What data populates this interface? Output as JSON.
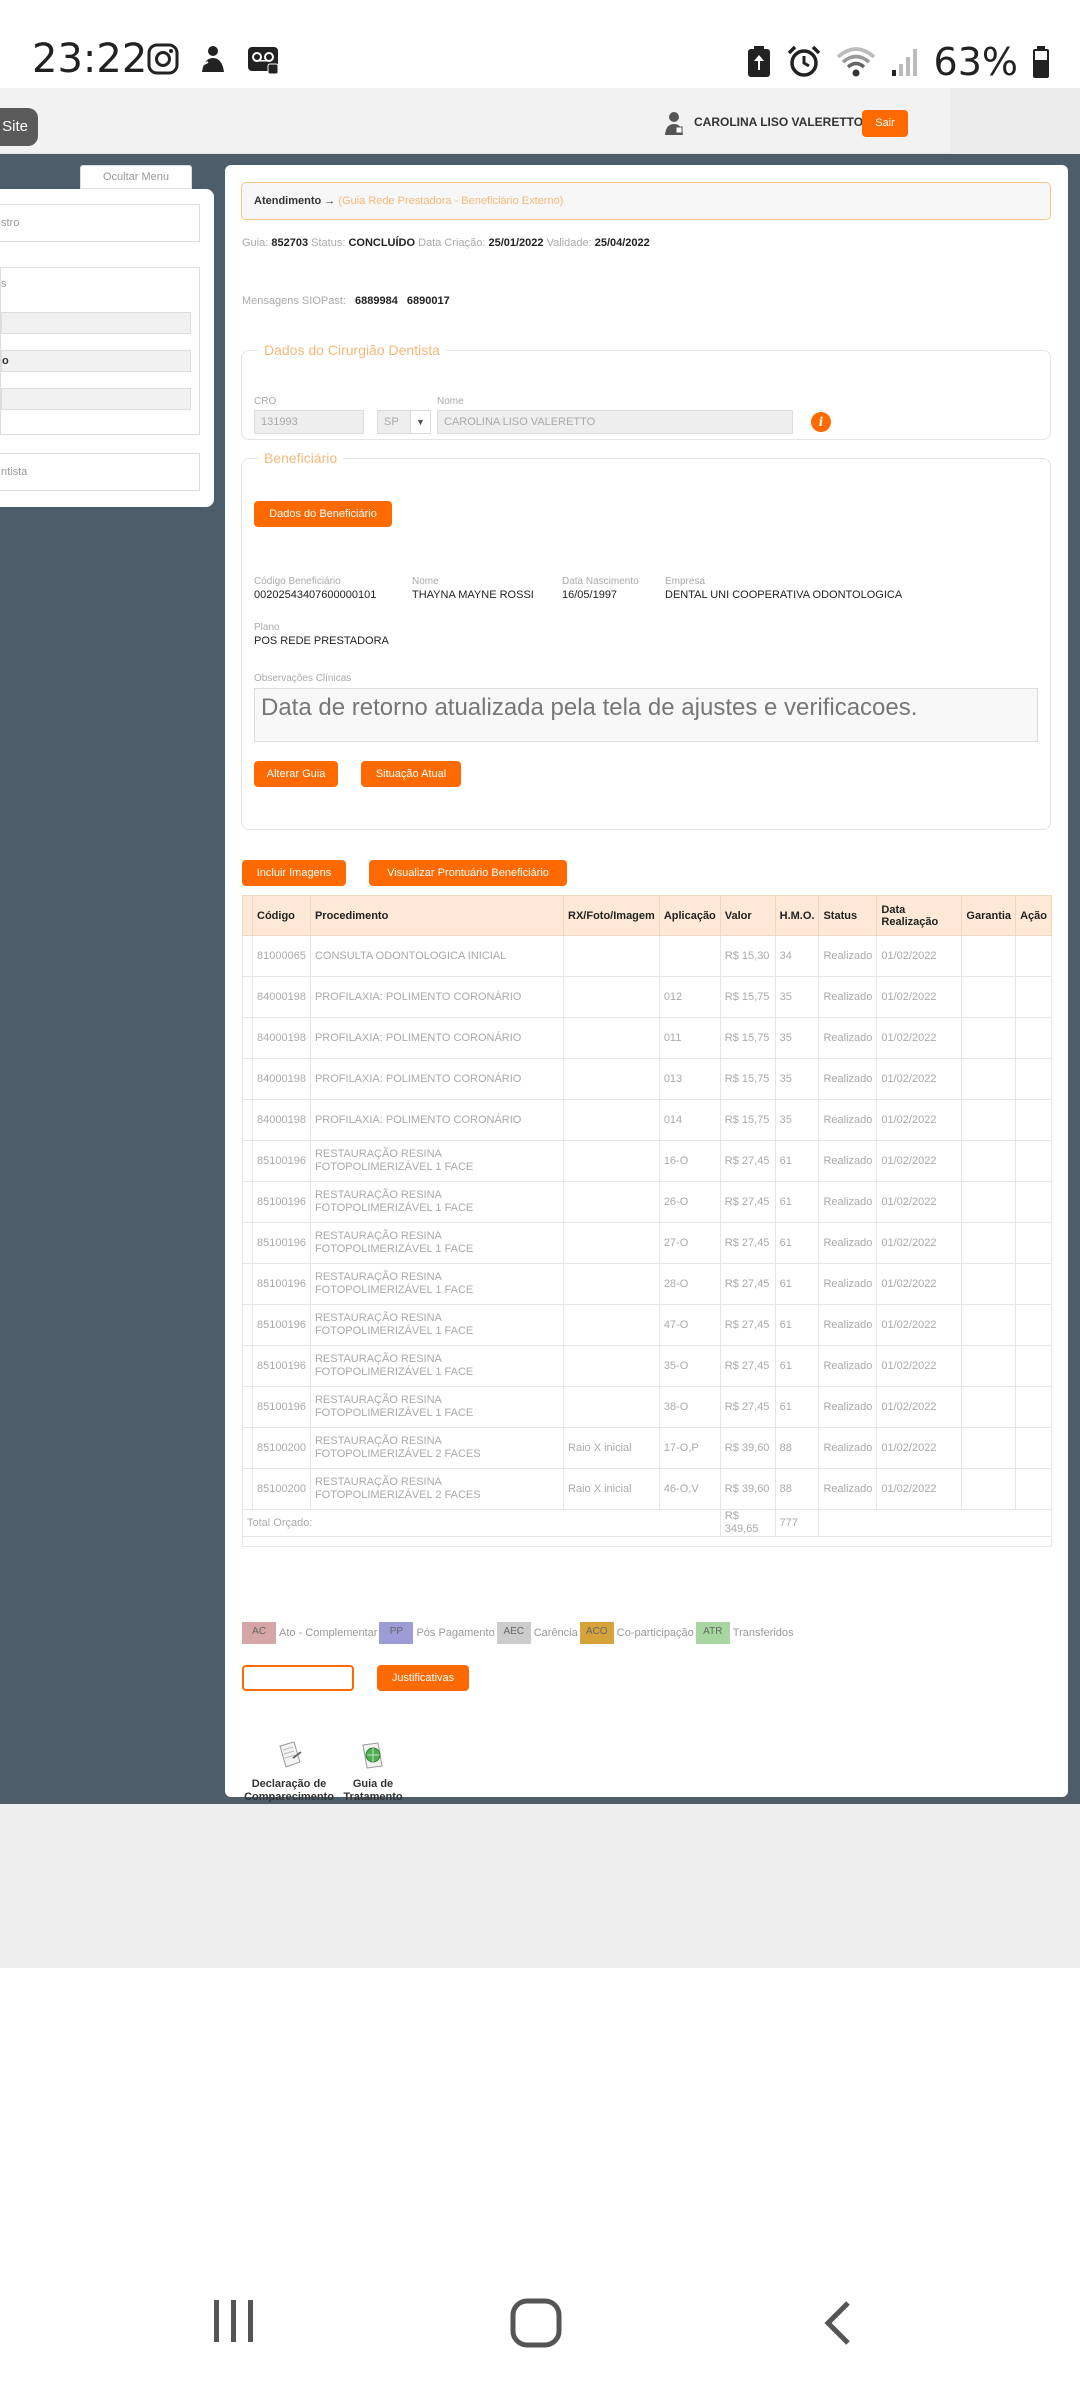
{
  "status_bar": {
    "time": "23:22",
    "battery": "63%"
  },
  "header": {
    "site_label": "Site",
    "user_name": "CAROLINA LISO VALERETTO",
    "logout_label": "Sair"
  },
  "sidebar": {
    "hide_menu_label": "Ocultar Menu",
    "field1": "stro",
    "field2": "s",
    "field3": "o",
    "field4": "ntista"
  },
  "breadcrumb": {
    "title": "Atendimento",
    "arrow": "→",
    "subtitle": "(Guia Rede Prestadora - Beneficiário Externo)"
  },
  "guide": {
    "guia_label": "Guia:",
    "guia": "852703",
    "status_label": "Status:",
    "status": "CONCLUÍDO",
    "created_label": "Data Criação:",
    "created": "25/01/2022",
    "validity_label": "Validade:",
    "validity": "25/04/2022"
  },
  "messages": {
    "label": "Mensagens SIOPast:",
    "m1": "6889984",
    "m2": "6890017"
  },
  "dentist": {
    "legend": "Dados do Cirurgião Dentista",
    "cro_label": "CRO",
    "cro": "131993",
    "uf": "SP",
    "name_label": "Nome",
    "name": "CAROLINA LISO VALERETTO",
    "info_glyph": "i"
  },
  "beneficiary": {
    "legend": "Beneficiário",
    "details_button": "Dados do Beneficiário",
    "code_label": "Código Beneficiário",
    "code": "00202543407600000101",
    "name_label": "Nome",
    "name": "THAYNA MAYNE ROSSI",
    "birth_label": "Data Nascimento",
    "birth": "16/05/1997",
    "company_label": "Empresa",
    "company": "DENTAL UNI COOPERATIVA ODONTOLOGICA",
    "plan_label": "Plano",
    "plan": "POS REDE PRESTADORA",
    "obs_label": "Observações Clínicas",
    "obs": "Data de retorno atualizada pela tela de ajustes e verificacoes.",
    "alter_button": "Alterar Guia",
    "situation_button": "Situação Atual"
  },
  "actions": {
    "include_images": "Incluir Imagens",
    "view_record": "Visualizar Prontuário Beneficiário"
  },
  "table": {
    "headers": [
      "Código",
      "Procedimento",
      "RX/Foto/Imagem",
      "Aplicação",
      "Valor",
      "H.M.O.",
      "Status",
      "Data Realização",
      "Garantia",
      "Ação"
    ],
    "rows": [
      {
        "code": "81000065",
        "proc": "CONSULTA ODONTOLOGICA INICIAL",
        "rx": "",
        "app": "",
        "value": "R$ 15,30",
        "hmo": "34",
        "status": "Realizado",
        "date": "01/02/2022"
      },
      {
        "code": "84000198",
        "proc": "PROFILAXIA: POLIMENTO CORONÁRIO",
        "rx": "",
        "app": "012",
        "value": "R$ 15,75",
        "hmo": "35",
        "status": "Realizado",
        "date": "01/02/2022"
      },
      {
        "code": "84000198",
        "proc": "PROFILAXIA: POLIMENTO CORONÁRIO",
        "rx": "",
        "app": "011",
        "value": "R$ 15,75",
        "hmo": "35",
        "status": "Realizado",
        "date": "01/02/2022"
      },
      {
        "code": "84000198",
        "proc": "PROFILAXIA: POLIMENTO CORONÁRIO",
        "rx": "",
        "app": "013",
        "value": "R$ 15,75",
        "hmo": "35",
        "status": "Realizado",
        "date": "01/02/2022"
      },
      {
        "code": "84000198",
        "proc": "PROFILAXIA: POLIMENTO CORONÁRIO",
        "rx": "",
        "app": "014",
        "value": "R$ 15,75",
        "hmo": "35",
        "status": "Realizado",
        "date": "01/02/2022"
      },
      {
        "code": "85100196",
        "proc": "RESTAURAÇÃO RESINA FOTOPOLIMERIZÁVEL 1 FACE",
        "rx": "",
        "app": "16-O",
        "value": "R$ 27,45",
        "hmo": "61",
        "status": "Realizado",
        "date": "01/02/2022"
      },
      {
        "code": "85100196",
        "proc": "RESTAURAÇÃO RESINA FOTOPOLIMERIZÁVEL 1 FACE",
        "rx": "",
        "app": "26-O",
        "value": "R$ 27,45",
        "hmo": "61",
        "status": "Realizado",
        "date": "01/02/2022"
      },
      {
        "code": "85100196",
        "proc": "RESTAURAÇÃO RESINA FOTOPOLIMERIZÁVEL 1 FACE",
        "rx": "",
        "app": "27-O",
        "value": "R$ 27,45",
        "hmo": "61",
        "status": "Realizado",
        "date": "01/02/2022"
      },
      {
        "code": "85100196",
        "proc": "RESTAURAÇÃO RESINA FOTOPOLIMERIZÁVEL 1 FACE",
        "rx": "",
        "app": "28-O",
        "value": "R$ 27,45",
        "hmo": "61",
        "status": "Realizado",
        "date": "01/02/2022"
      },
      {
        "code": "85100196",
        "proc": "RESTAURAÇÃO RESINA FOTOPOLIMERIZÁVEL 1 FACE",
        "rx": "",
        "app": "47-O",
        "value": "R$ 27,45",
        "hmo": "61",
        "status": "Realizado",
        "date": "01/02/2022"
      },
      {
        "code": "85100196",
        "proc": "RESTAURAÇÃO RESINA FOTOPOLIMERIZÁVEL 1 FACE",
        "rx": "",
        "app": "35-O",
        "value": "R$ 27,45",
        "hmo": "61",
        "status": "Realizado",
        "date": "01/02/2022"
      },
      {
        "code": "85100196",
        "proc": "RESTAURAÇÃO RESINA FOTOPOLIMERIZÁVEL 1 FACE",
        "rx": "",
        "app": "38-O",
        "value": "R$ 27,45",
        "hmo": "61",
        "status": "Realizado",
        "date": "01/02/2022"
      },
      {
        "code": "85100200",
        "proc": "RESTAURAÇÃO RESINA FOTOPOLIMERIZÁVEL 2 FACES",
        "rx": "Raio X inicial",
        "app": "17-O,P",
        "value": "R$ 39,60",
        "hmo": "88",
        "status": "Realizado",
        "date": "01/02/2022"
      },
      {
        "code": "85100200",
        "proc": "RESTAURAÇÃO RESINA FOTOPOLIMERIZÁVEL 2 FACES",
        "rx": "Raio X inicial",
        "app": "46-O,V",
        "value": "R$ 39,60",
        "hmo": "88",
        "status": "Realizado",
        "date": "01/02/2022"
      }
    ],
    "total_label": "Total Orçado:",
    "total_value": "R$ 349,65",
    "total_hmo": "777"
  },
  "legend": [
    {
      "code": "AC",
      "label": "Ato - Complementar",
      "color": "#d6a5a5"
    },
    {
      "code": "PP",
      "label": "Pós Pagamento",
      "color": "#9c9cd6"
    },
    {
      "code": "AEC",
      "label": "Carência",
      "color": "#cccccc"
    },
    {
      "code": "ACO",
      "label": "Co-participação",
      "color": "#d6a33a"
    },
    {
      "code": "ATR",
      "label": "Transferidos",
      "color": "#a8d6a0"
    }
  ],
  "justify_button": "Justificativas",
  "documents": {
    "declaration": "Declaração de Comparecimento",
    "treatment": "Guia de Tratamento"
  }
}
